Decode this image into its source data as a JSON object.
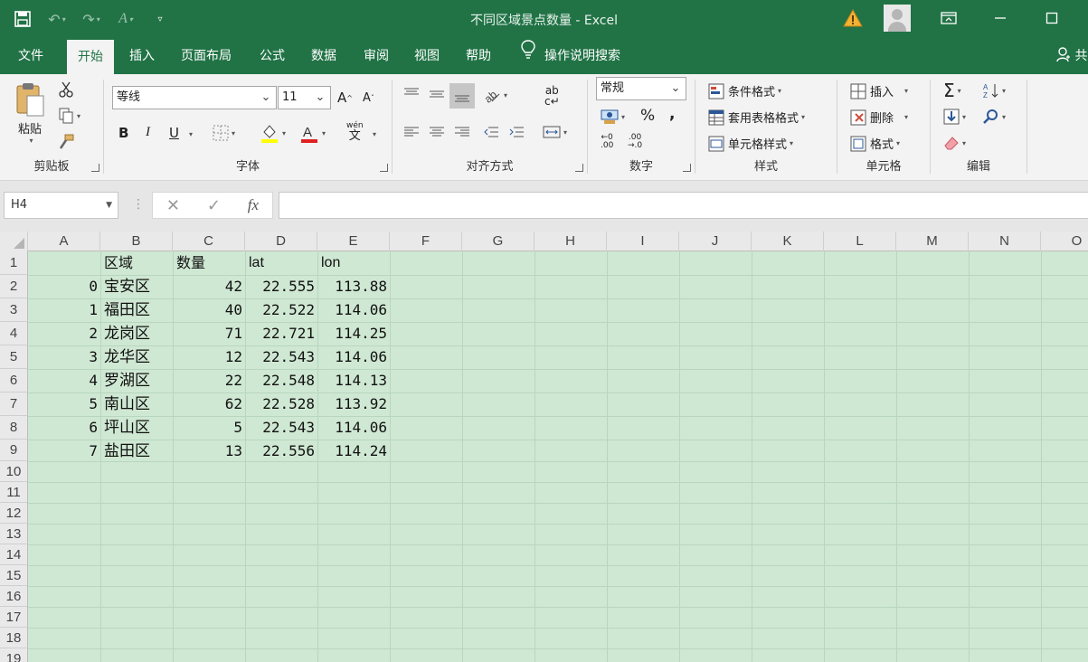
{
  "window": {
    "title": "不同区域景点数量  -  Excel"
  },
  "tabs": [
    {
      "label": "文件"
    },
    {
      "label": "开始"
    },
    {
      "label": "插入"
    },
    {
      "label": "页面布局"
    },
    {
      "label": "公式"
    },
    {
      "label": "数据"
    },
    {
      "label": "审阅"
    },
    {
      "label": "视图"
    },
    {
      "label": "帮助"
    }
  ],
  "tell_me": "操作说明搜索",
  "share": "共",
  "ribbon": {
    "clipboard": {
      "paste": "粘贴",
      "label": "剪贴板"
    },
    "font": {
      "name": "等线",
      "size": "11",
      "bold": "B",
      "italic": "I",
      "underline": "U",
      "label": "字体",
      "phonetic_top": "wén",
      "phonetic_bottom": "文"
    },
    "alignment": {
      "label": "对齐方式"
    },
    "number": {
      "format": "常规",
      "percent": "%",
      "comma": ",",
      "label": "数字"
    },
    "styles": {
      "conditional": "条件格式",
      "table": "套用表格格式",
      "cell": "单元格样式",
      "label": "样式"
    },
    "cells": {
      "insert": "插入",
      "delete": "删除",
      "format": "格式",
      "label": "单元格"
    },
    "editing": {
      "label": "编辑"
    }
  },
  "formula_bar": {
    "name_box": "H4",
    "fx": "fx",
    "value": ""
  },
  "sheet": {
    "columns": [
      "A",
      "B",
      "C",
      "D",
      "E",
      "F",
      "G",
      "H",
      "I",
      "J",
      "K",
      "L",
      "M",
      "N",
      "O"
    ],
    "rows": [
      "1",
      "2",
      "3",
      "4",
      "5",
      "6",
      "7",
      "8",
      "9",
      "10",
      "11",
      "12",
      "13",
      "14",
      "15",
      "16",
      "17",
      "18",
      "19"
    ],
    "header": {
      "b": "区域",
      "c": "数量",
      "d": "lat",
      "e": "lon"
    },
    "data": [
      {
        "a": "0",
        "b": "宝安区",
        "c": "42",
        "d": "22.555",
        "e": "113.88"
      },
      {
        "a": "1",
        "b": "福田区",
        "c": "40",
        "d": "22.522",
        "e": "114.06"
      },
      {
        "a": "2",
        "b": "龙岗区",
        "c": "71",
        "d": "22.721",
        "e": "114.25"
      },
      {
        "a": "3",
        "b": "龙华区",
        "c": "12",
        "d": "22.543",
        "e": "114.06"
      },
      {
        "a": "4",
        "b": "罗湖区",
        "c": "22",
        "d": "22.548",
        "e": "114.13"
      },
      {
        "a": "5",
        "b": "南山区",
        "c": "62",
        "d": "22.528",
        "e": "113.92"
      },
      {
        "a": "6",
        "b": "坪山区",
        "c": "5",
        "d": "22.543",
        "e": "114.06"
      },
      {
        "a": "7",
        "b": "盐田区",
        "c": "13",
        "d": "22.556",
        "e": "114.24"
      }
    ]
  }
}
